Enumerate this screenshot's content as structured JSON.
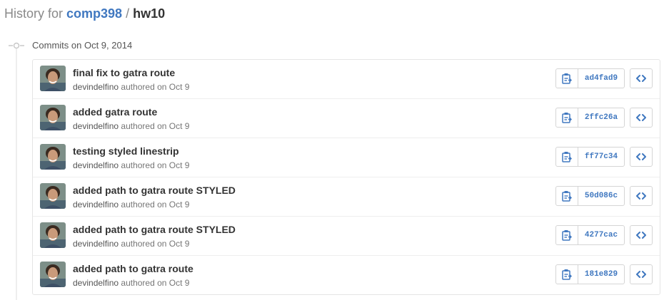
{
  "header": {
    "prefix": "History for",
    "owner": "comp398",
    "separator": "/",
    "repo": "hw10"
  },
  "group": {
    "title": "Commits on Oct 9, 2014"
  },
  "colors": {
    "link": "#4078c0",
    "border": "#e5e5e5",
    "muted": "#767676"
  },
  "commits": [
    {
      "title": "final fix to gatra route",
      "author": "devindelfino",
      "meta": "authored on Oct 9",
      "sha": "ad4fad9"
    },
    {
      "title": "added gatra route",
      "author": "devindelfino",
      "meta": "authored on Oct 9",
      "sha": "2ffc26a"
    },
    {
      "title": "testing styled linestrip",
      "author": "devindelfino",
      "meta": "authored on Oct 9",
      "sha": "ff77c34"
    },
    {
      "title": "added path to gatra route STYLED",
      "author": "devindelfino",
      "meta": "authored on Oct 9",
      "sha": "50d086c"
    },
    {
      "title": "added path to gatra route STYLED",
      "author": "devindelfino",
      "meta": "authored on Oct 9",
      "sha": "4277cac"
    },
    {
      "title": "added path to gatra route",
      "author": "devindelfino",
      "meta": "authored on Oct 9",
      "sha": "181e829"
    }
  ],
  "icons": {
    "commit_group": "git-commit-icon",
    "copy": "clippy-icon",
    "browse": "code-icon"
  }
}
